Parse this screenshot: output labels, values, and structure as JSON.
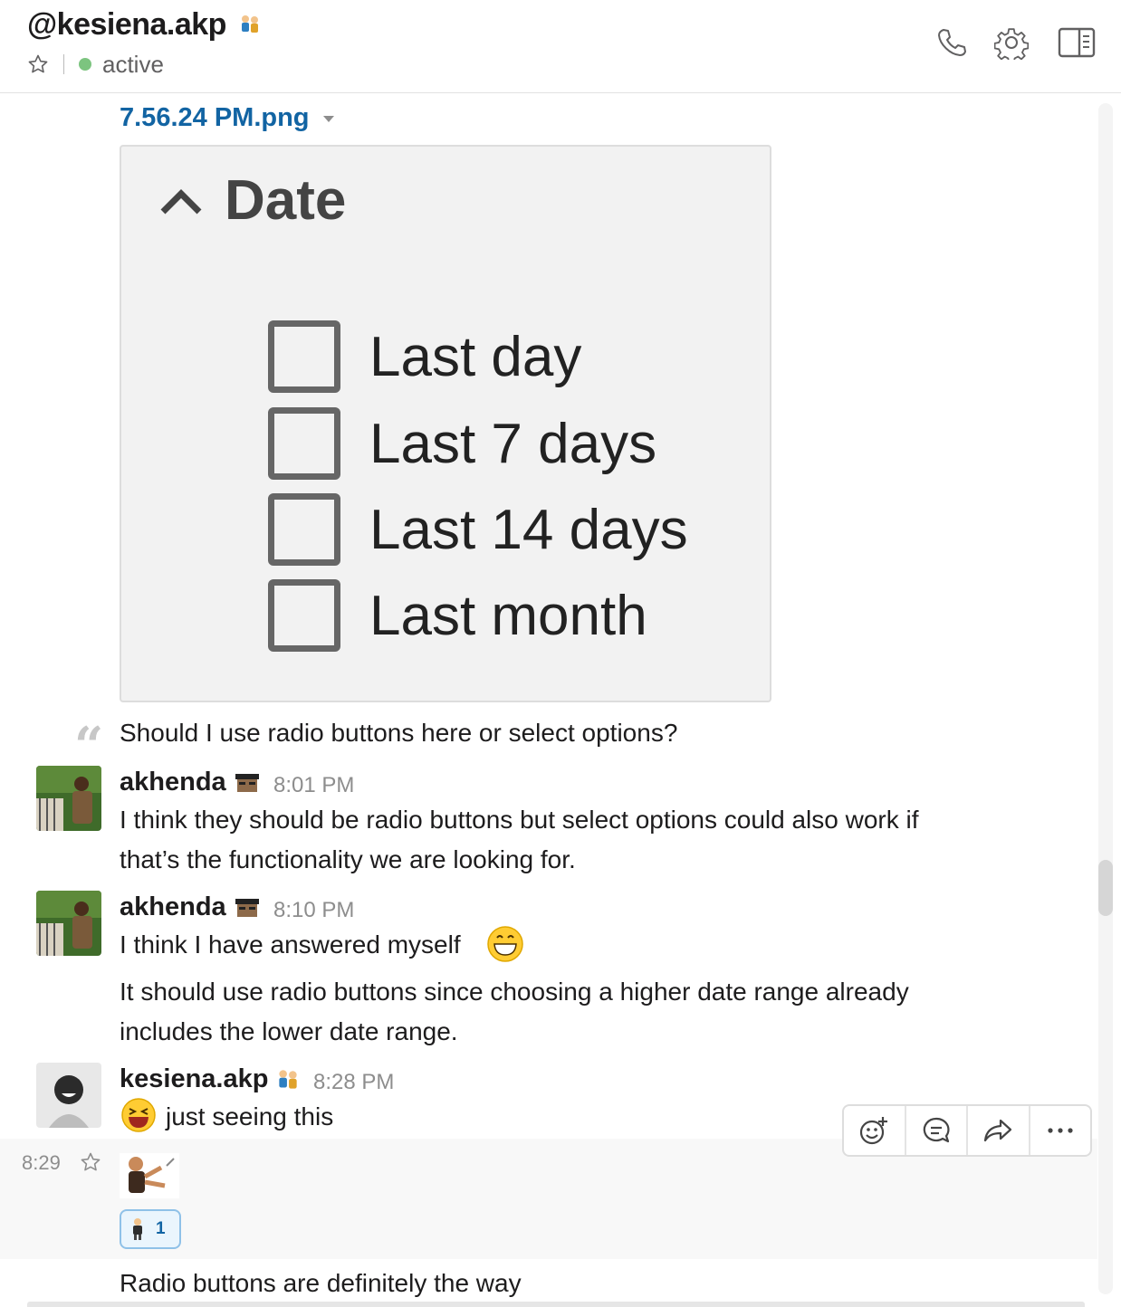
{
  "header": {
    "title": "@kesiena.akp",
    "presence": "active"
  },
  "file": {
    "name": "7.56.24 PM.png",
    "image": {
      "heading": "Date",
      "options": [
        "Last day",
        "Last 7 days",
        "Last 14 days",
        "Last month"
      ]
    }
  },
  "quote": {
    "text": "Should I use radio buttons here or select options?"
  },
  "messages": [
    {
      "author": "akhenda",
      "time": "8:01 PM",
      "lines": [
        "I think they should be radio buttons but select options could also work if",
        "that’s the functionality we are looking for."
      ]
    },
    {
      "author": "akhenda",
      "time": "8:10 PM",
      "lines": [
        "I think I have answered myself",
        "It should use radio buttons since choosing a higher date range already",
        "includes the lower date range."
      ]
    },
    {
      "author": "kesiena.akp",
      "time": "8:28 PM",
      "lines": [
        "just seeing this"
      ]
    }
  ],
  "hover_message": {
    "time": "8:29",
    "reaction_count": "1"
  },
  "last_message": {
    "text": "Radio buttons are definitely the way"
  },
  "colors": {
    "link": "#1264a3",
    "presence": "#7cc47f",
    "reaction_border": "#8fc1e8"
  }
}
